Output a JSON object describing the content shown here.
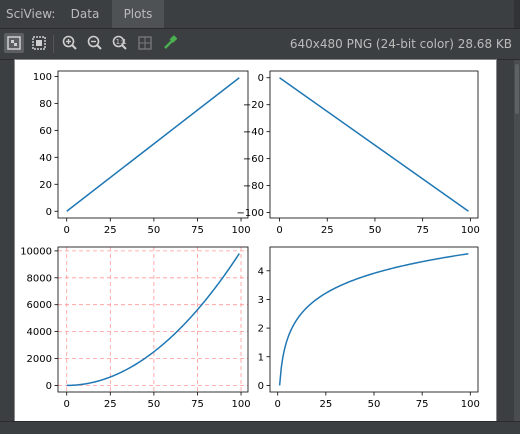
{
  "window": {
    "title": "SciView:"
  },
  "tabs": [
    {
      "label": "Data"
    },
    {
      "label": "Plots"
    }
  ],
  "toolbar": {
    "buttons": [
      {
        "name": "actual-size-icon"
      },
      {
        "name": "fit-to-window-icon"
      },
      {
        "name": "zoom-in-icon"
      },
      {
        "name": "zoom-out-icon"
      },
      {
        "name": "zoom-reset-icon"
      },
      {
        "name": "grid-toggle-icon"
      },
      {
        "name": "color-picker-icon"
      }
    ],
    "file_info": "640x480 PNG (24-bit color) 28.68 KB"
  },
  "colors": {
    "line": "#1f77b4",
    "grid": "#ff9999",
    "background": "#3c3f41",
    "tab_active": "#4e5254"
  },
  "chart_data": [
    {
      "type": "line",
      "x": [
        0,
        99
      ],
      "series": [
        {
          "values": [
            0,
            99
          ]
        }
      ],
      "xlim": [
        -5,
        104
      ],
      "ylim": [
        -5,
        104
      ],
      "xticks": [
        "0",
        "25",
        "50",
        "75",
        "100"
      ],
      "yticks": [
        "0",
        "20",
        "40",
        "60",
        "80",
        "100"
      ],
      "grid": false
    },
    {
      "type": "line",
      "x": [
        0,
        99
      ],
      "series": [
        {
          "values": [
            0,
            -99
          ]
        }
      ],
      "xlim": [
        -5,
        104
      ],
      "ylim": [
        -104,
        5
      ],
      "xticks": [
        "0",
        "25",
        "50",
        "75",
        "100"
      ],
      "yticks": [
        "0",
        "−20",
        "−40",
        "−60",
        "−80",
        "−100"
      ],
      "grid": false
    },
    {
      "type": "line",
      "function": "x^2",
      "x_range": [
        0,
        99
      ],
      "xlim": [
        -5,
        104
      ],
      "ylim": [
        -490,
        10290
      ],
      "xticks": [
        "0",
        "25",
        "50",
        "75",
        "100"
      ],
      "yticks": [
        "0",
        "2000",
        "4000",
        "6000",
        "8000",
        "10000"
      ],
      "grid": true,
      "grid_style": "dashed"
    },
    {
      "type": "line",
      "function": "ln(x)",
      "x_range": [
        1,
        99
      ],
      "xlim": [
        -4,
        104
      ],
      "ylim": [
        -0.23,
        4.83
      ],
      "xticks": [
        "0",
        "25",
        "50",
        "75",
        "100"
      ],
      "yticks": [
        "0",
        "1",
        "2",
        "3",
        "4"
      ],
      "grid": false
    }
  ]
}
